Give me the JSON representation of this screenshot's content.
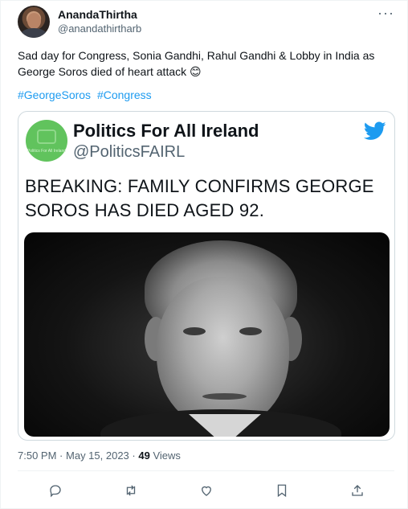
{
  "author": {
    "display_name": "AnandaThirtha",
    "handle": "@anandathirtharb"
  },
  "menu_icon": "more-dots-icon",
  "tweet": {
    "text": "Sad day for Congress, Sonia Gandhi, Rahul Gandhi & Lobby in India as George Soros died of heart attack 😊",
    "hashtags": [
      "#GeorgeSoros",
      "#Congress"
    ]
  },
  "embedded": {
    "name": "Politics For All Ireland",
    "handle": "@PoliticsFAIRL",
    "logo_text": "Politics For All Ireland",
    "headline": "BREAKING: FAMILY CONFIRMS GEORGE SOROS HAS DIED AGED 92.",
    "brand_icon": "twitter-bird-icon"
  },
  "meta": {
    "time": "7:50 PM",
    "separator": "·",
    "date": "May 15, 2023",
    "views_count": "49",
    "views_label": "Views"
  },
  "actions": [
    "reply-icon",
    "retweet-icon",
    "like-icon",
    "bookmark-icon",
    "share-icon"
  ],
  "colors": {
    "link": "#1d9bf0",
    "secondary_text": "#536471",
    "avatar_green": "#61c35d"
  }
}
